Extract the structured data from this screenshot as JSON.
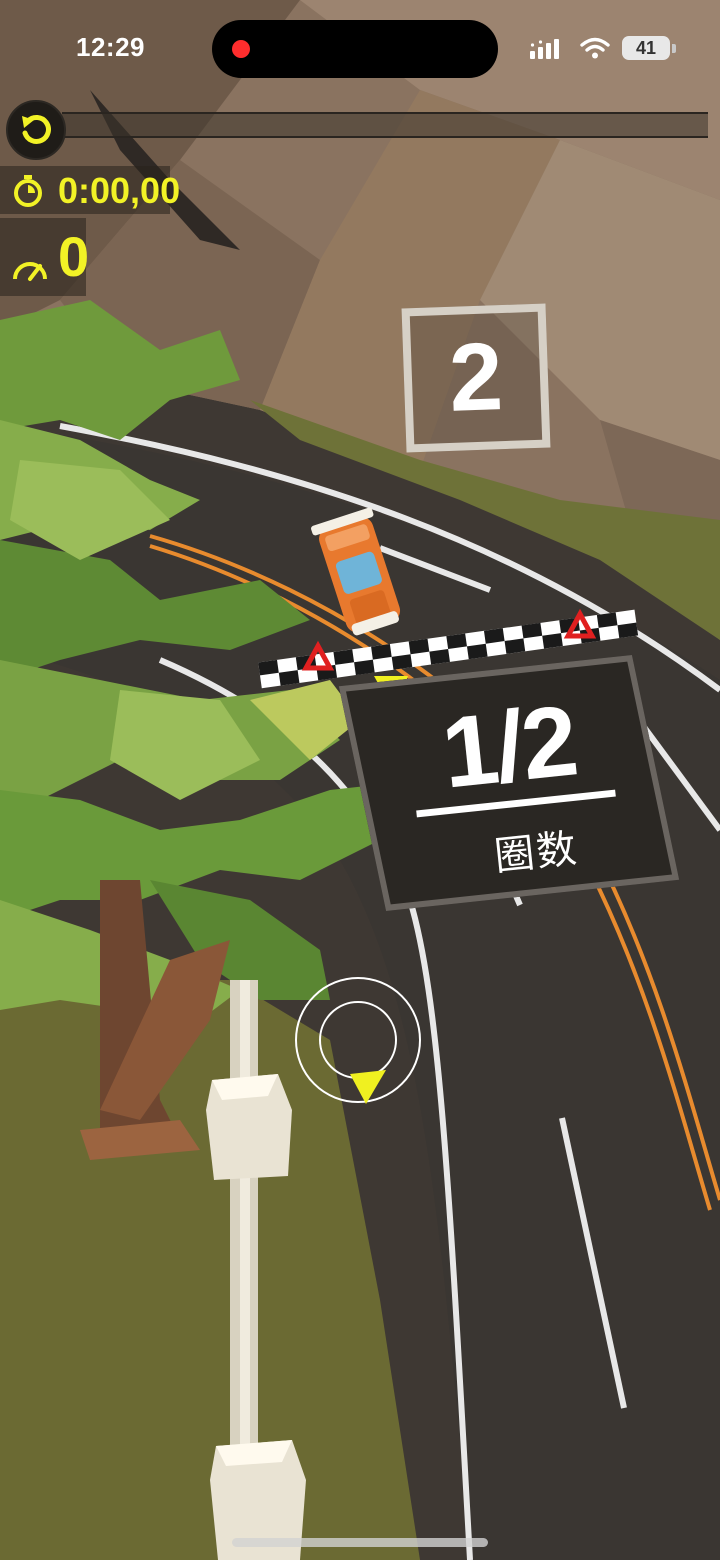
{
  "status_bar": {
    "time": "12:29",
    "battery": "41"
  },
  "hud": {
    "timer": "0:00,00",
    "speed": "0"
  },
  "track": {
    "turn_sign_number": "2",
    "lap_counter": "1/2",
    "lap_label": "圈数"
  },
  "icons": [
    "restart-icon",
    "stopwatch-icon",
    "speedometer-icon",
    "signal-icon",
    "wifi-icon",
    "battery-icon"
  ],
  "colors": {
    "hud_accent": "#f2f226",
    "road": "#3a3632",
    "car": "#e8792e",
    "foliage": "#6f9a3c",
    "mountain": "#8a7360",
    "grass": "#6b6a33"
  }
}
